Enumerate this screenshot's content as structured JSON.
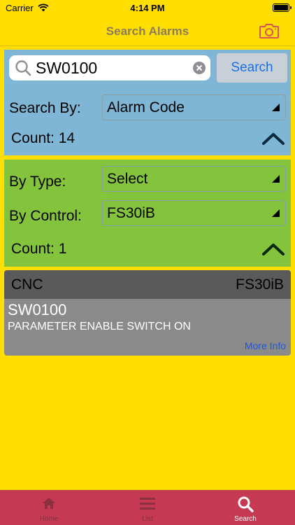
{
  "status": {
    "carrier": "Carrier",
    "time": "4:14 PM"
  },
  "nav": {
    "title": "Search Alarms",
    "camera_icon": "camera-icon"
  },
  "search": {
    "input_value": "SW0100",
    "button_label": "Search",
    "by_label": "Search By:",
    "by_value": "Alarm Code",
    "count_label": "Count: 14"
  },
  "filter": {
    "type_label": "By Type:",
    "type_value": "Select",
    "control_label": "By Control:",
    "control_value": "FS30iB",
    "count_label": "Count: 1"
  },
  "result": {
    "type": "CNC",
    "control": "FS30iB",
    "code": "SW0100",
    "description": "PARAMETER ENABLE SWITCH ON",
    "more_info": "More Info"
  },
  "tabs": [
    {
      "label": "Home",
      "icon": "home-icon",
      "active": false
    },
    {
      "label": "List",
      "icon": "list-icon",
      "active": false
    },
    {
      "label": "Search",
      "icon": "search-icon",
      "active": true
    }
  ],
  "colors": {
    "background": "#ffde00",
    "search_panel": "#7fb6d6",
    "filter_panel": "#84c33c",
    "tab_bar": "#c53a52",
    "link": "#1b57e6"
  }
}
